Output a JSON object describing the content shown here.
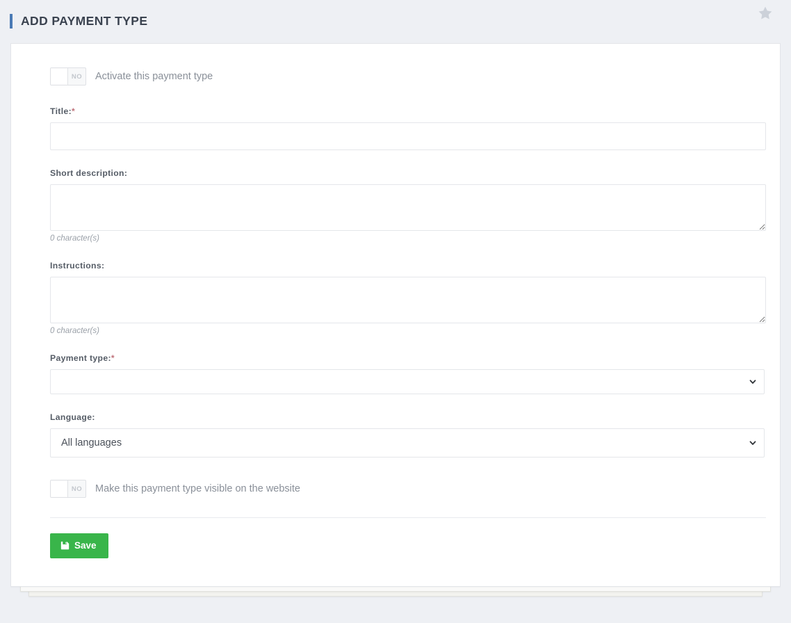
{
  "header": {
    "title": "ADD PAYMENT TYPE",
    "accent_color": "#4a7ab5",
    "favorite_icon": "star-icon"
  },
  "form": {
    "activate_toggle": {
      "state_label": "NO",
      "label": "Activate this payment type",
      "checked": false
    },
    "title_field": {
      "label": "Title:",
      "required_mark": "*",
      "value": "",
      "placeholder": ""
    },
    "short_description_field": {
      "label": "Short description:",
      "value": "",
      "placeholder": "",
      "char_count": "0 character(s)"
    },
    "instructions_field": {
      "label": "Instructions:",
      "value": "",
      "placeholder": "",
      "char_count": "0 character(s)"
    },
    "payment_type_select": {
      "label": "Payment type:",
      "required_mark": "*",
      "selected": "",
      "options": [
        ""
      ]
    },
    "language_select": {
      "label": "Language:",
      "selected": "All languages",
      "options": [
        "All languages"
      ]
    },
    "visible_toggle": {
      "state_label": "NO",
      "label": "Make this payment type visible on the website",
      "checked": false
    },
    "save_button": {
      "label": "Save",
      "icon": "floppy-disk-icon",
      "color": "#39b54a"
    }
  }
}
